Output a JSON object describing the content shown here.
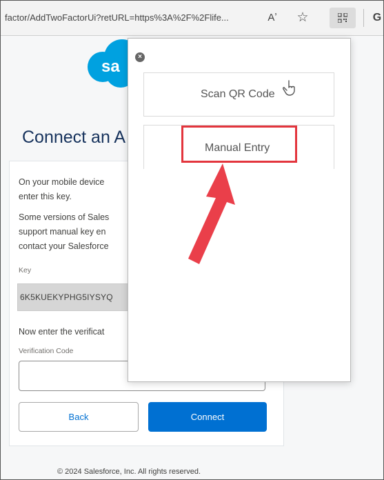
{
  "browser": {
    "url": "factor/AddTwoFactorUi?retURL=https%3A%2F%2Flife...",
    "icons": [
      "read-aloud-icon",
      "favorite-star-icon",
      "qr-extension-icon",
      "refresh-icon"
    ],
    "read_aloud": "Aʼ",
    "star": "☆",
    "refresh": "G"
  },
  "page": {
    "logo_text": "sa",
    "heading": "Connect an A",
    "instructions_1": [
      "On your mobile device",
      "enter this key."
    ],
    "instructions_2": [
      "Some versions of Sales",
      "support manual key en",
      "contact your Salesforce"
    ],
    "key_label": "Key",
    "key_value": "6K5KUEKYPHG5IYSYQ",
    "verify_prompt": "Now enter the verificat",
    "verification_label": "Verification Code",
    "verification_value": "",
    "back_label": "Back",
    "connect_label": "Connect",
    "footer": "© 2024 Salesforce, Inc. All rights reserved."
  },
  "popup": {
    "close_glyph": "×",
    "scan_qr_label": "Scan QR Code",
    "manual_entry_label": "Manual Entry"
  },
  "colors": {
    "salesforce_blue": "#00a1e0",
    "button_blue": "#0070d2",
    "highlight_red": "#e3353d"
  }
}
